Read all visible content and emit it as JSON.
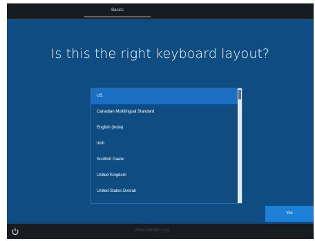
{
  "header": {
    "tab_label": "Basics"
  },
  "main": {
    "title": "Is this the right keyboard layout?",
    "keyboard_layouts": [
      "US",
      "Canadian Multilingual Standard",
      "English (India)",
      "Irish",
      "Scottish Gaelic",
      "United Kingdom",
      "United States-Dvorak"
    ],
    "selected_index": 0,
    "yes_label": "Yes"
  },
  "footer": {
    "accessibility_icon": "ease-of-access-icon",
    "watermark": "www.wintips.org"
  },
  "colors": {
    "background": "#0f4c82",
    "selection": "#1b6ec2",
    "button": "#1d7fd6",
    "bar": "#171c20"
  }
}
